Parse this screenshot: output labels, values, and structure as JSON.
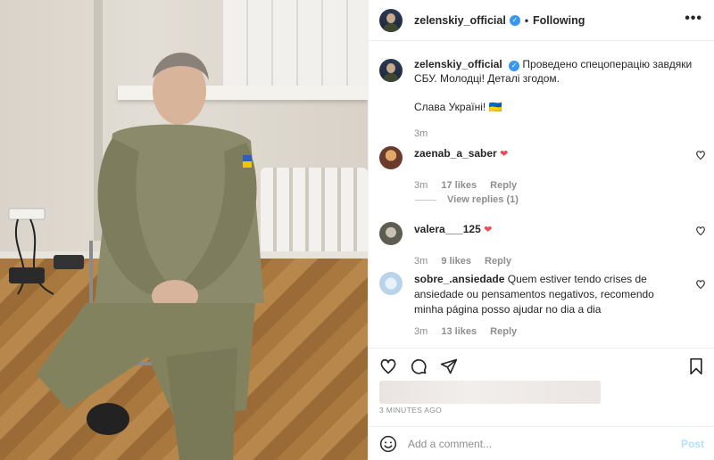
{
  "header": {
    "username": "zelenskiy_official",
    "separator": "•",
    "follow_state": "Following",
    "more_glyph": "•••"
  },
  "caption": {
    "username": "zelenskiy_official",
    "text_line1": "Проведено спецоперацію завдяки СБУ. Молодці! Деталі згодом.",
    "text_line2": "Слава Україні! 🇺🇦",
    "time": "3m"
  },
  "comments": [
    {
      "username": "zaenab_a_saber",
      "text": "❤",
      "time": "3m",
      "likes": "17 likes",
      "reply": "Reply",
      "avatar_color": "#6a3b2c"
    },
    {
      "username": "valera___125",
      "text": "❤",
      "time": "3m",
      "likes": "9 likes",
      "reply": "Reply",
      "avatar_color": "#6b6a5f"
    },
    {
      "username": "sobre_.ansiedade",
      "text": "Quem estiver tendo crises de ansiedade ou pensamentos negativos, recomendo minha página posso ajudar no dia a dia",
      "time": "3m",
      "likes": "13 likes",
      "reply": "Reply",
      "avatar_color": "#b9d3ea"
    }
  ],
  "view_replies": "View replies (1)",
  "actions": {
    "icons": [
      "heart-icon",
      "comment-icon",
      "share-icon",
      "bookmark-icon"
    ],
    "time_ago": "3 MINUTES AGO"
  },
  "add_comment": {
    "placeholder": "Add a comment...",
    "post_label": "Post"
  },
  "colors": {
    "verified": "#3897f0",
    "heart": "#ed4956",
    "post_disabled": "#b2dffc",
    "muted": "#8e8e8e"
  }
}
